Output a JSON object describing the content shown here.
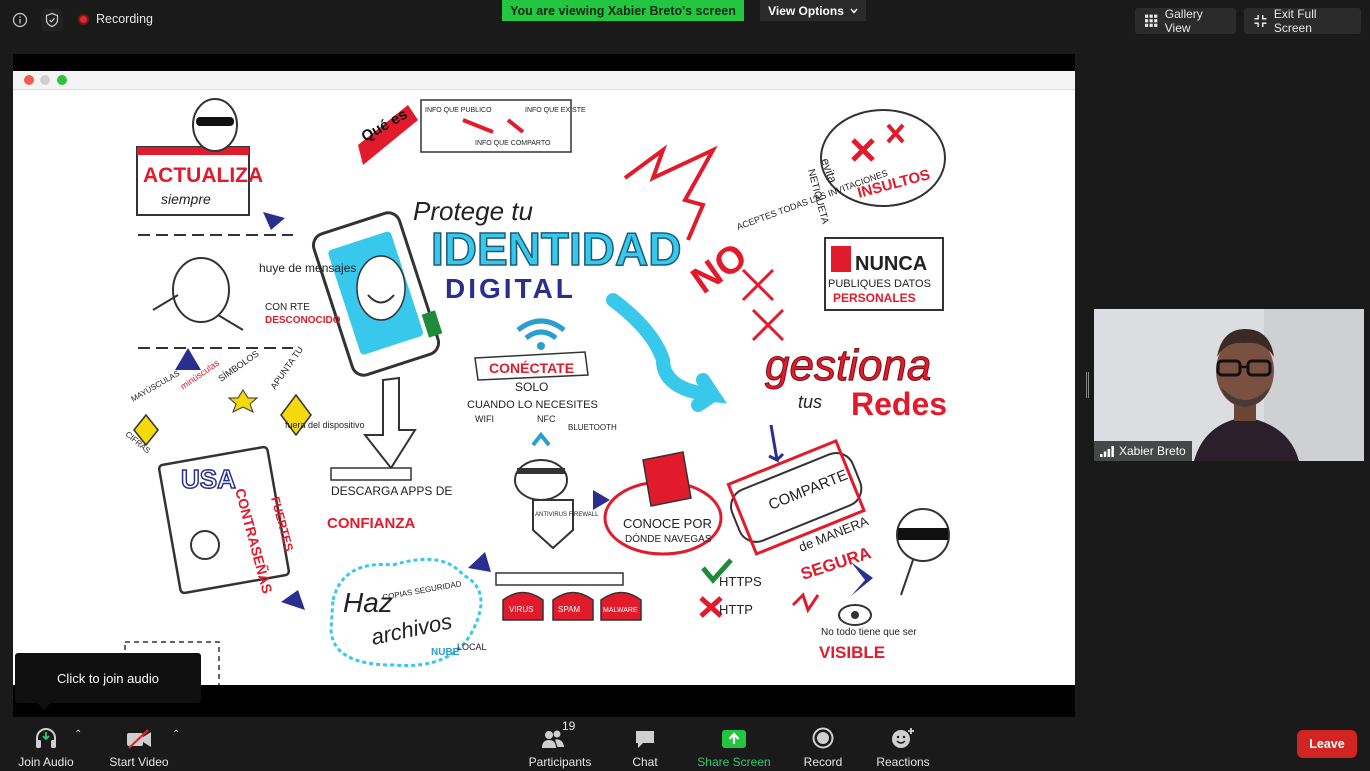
{
  "topbar": {
    "recording_label": "Recording",
    "viewing_banner": "You are viewing Xabier Breto's screen",
    "view_options_label": "View Options",
    "gallery_view_label": "Gallery View",
    "exit_fullscreen_label": "Exit Full Screen"
  },
  "infographic": {
    "actualiza": "ACTUALIZA",
    "siempre": "siempre",
    "que_es": "Qué es",
    "info_publico": "INFO QUE PUBLICO",
    "info_comparto": "INFO QUE COMPARTO",
    "info_existe": "INFO QUE EXISTE",
    "protege_tu": "Protege tu",
    "identidad": "IDENTIDAD",
    "digital": "DIGITAL",
    "evita": "evita",
    "insultos": "INSULTOS",
    "netiqueta": "NETIQUETA",
    "no": "NO",
    "aceptes_invitaciones": "ACEPTES TODAS LAS INVITACIONES",
    "nunca": "NUNCA",
    "publiques_datos": "PUBLIQUES DATOS",
    "personales": "PERSONALES",
    "huye_de_mensajes": "huye de mensajes",
    "con_remitente": "CON RTE",
    "desconocido": "DESCONOCIDO",
    "conectate": "CONÉCTATE",
    "solo": "SOLO",
    "cuando_necesites": "CUANDO LO NECESITES",
    "wifi": "WIFI",
    "nfc": "NFC",
    "bluetooth": "BLUETOOTH",
    "gestiona": "gestiona",
    "tus": "tus",
    "redes": "Redes",
    "usa": "USA",
    "contrasenas": "CONTRASEÑAS",
    "fuertes": "FUERTES",
    "apunta_tu": "APUNTA TU",
    "fuera_dispositivo": "fuera del dispositivo",
    "mayusculas": "MAYÚSCULAS",
    "minusculas": "minúsculas",
    "simbolos": "SÍMBOLOS",
    "cifras": "CIFRAS",
    "descarga_apps": "DESCARGA APPS DE",
    "confianza": "CONFIANZA",
    "antivirus_firewall": "ANTIVIRUS FIREWALL",
    "conoce_por": "CONOCE POR",
    "donde_navegas": "DÓNDE NAVEGAS",
    "https": "HTTPS",
    "http": "HTTP",
    "comparte": "COMPARTE",
    "de_manera": "de MANERA",
    "segura": "SEGURA",
    "haz": "Haz",
    "copias_seguridad": "COPIAS SEGURIDAD",
    "archivos": "archivos",
    "nube": "NUBE",
    "local": "LOCAL",
    "virus": "VIRUS",
    "spam": "SPAM",
    "malware": "MALWARE",
    "no_todo_tiene": "No todo tiene que ser",
    "visible": "VISIBLE"
  },
  "participant": {
    "name": "Xabier Breto"
  },
  "tooltip": {
    "text": "Click to join audio"
  },
  "toolbar": {
    "join_audio": "Join Audio",
    "start_video": "Start Video",
    "participants": "Participants",
    "participants_count": "19",
    "chat": "Chat",
    "share_screen": "Share Screen",
    "record": "Record",
    "reactions": "Reactions",
    "leave": "Leave"
  },
  "colors": {
    "banner_green": "#23c640",
    "leave_red": "#d32424",
    "share_green": "#2ecc71",
    "ink_red": "#e21b2c",
    "ink_cyan": "#38c8ec",
    "ink_navy": "#2a2f8f"
  }
}
